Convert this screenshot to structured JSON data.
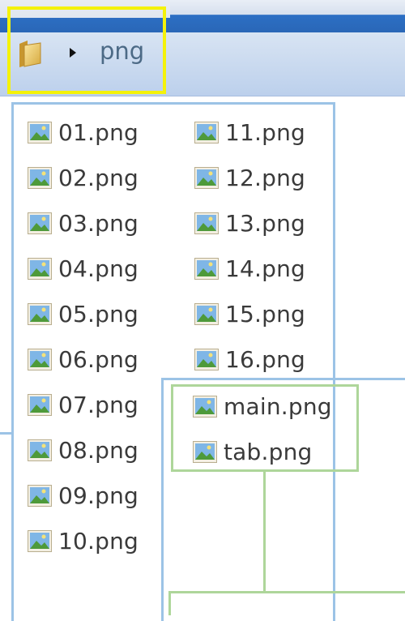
{
  "breadcrumb": {
    "folder_icon": "folder-icon",
    "arrow_icon": "chevron-right-icon",
    "current": "png"
  },
  "files": {
    "column1": [
      "01.png",
      "02.png",
      "03.png",
      "04.png",
      "05.png",
      "06.png",
      "07.png",
      "08.png",
      "09.png",
      "10.png"
    ],
    "column2": [
      "11.png",
      "12.png",
      "13.png",
      "14.png",
      "15.png",
      "16.png"
    ],
    "group2": [
      "main.png",
      "tab.png"
    ]
  },
  "colors": {
    "highlight_yellow": "#f4f20a",
    "annotation_blue": "#9cc3e6",
    "annotation_green": "#aed69a",
    "titlebar_blue": "#2a67b7"
  }
}
